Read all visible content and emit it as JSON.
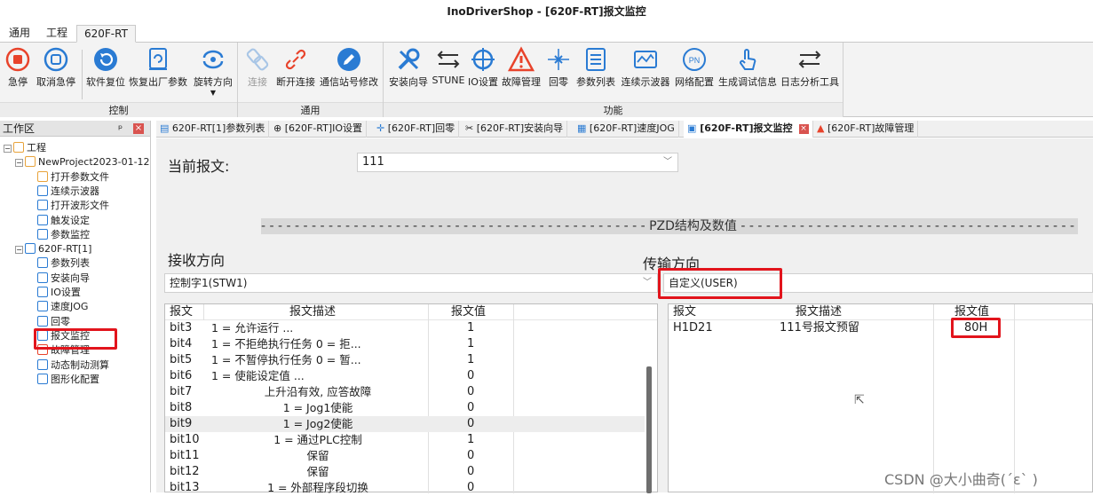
{
  "window": {
    "title": "InoDriverShop - [620F-RT]报文监控"
  },
  "menu_tabs": [
    "通用",
    "工程",
    "620F-RT"
  ],
  "ribbon": {
    "groups": [
      {
        "label": "控制",
        "buttons": [
          {
            "label": "急停",
            "icon": "stop-icon"
          },
          {
            "label": "取消急停",
            "icon": "cancel-stop-icon"
          },
          {
            "label": "软件复位",
            "icon": "reset-icon"
          },
          {
            "label": "恢复出厂参数",
            "icon": "factory-reset-icon"
          },
          {
            "label": "旋转方向",
            "icon": "rotate-direction-icon"
          }
        ]
      },
      {
        "label": "通用",
        "buttons": [
          {
            "label": "连接",
            "icon": "connect-icon"
          },
          {
            "label": "断开连接",
            "icon": "disconnect-icon"
          },
          {
            "label": "通信站号修改",
            "icon": "edit-station-icon"
          }
        ]
      },
      {
        "label": "功能",
        "buttons": [
          {
            "label": "安装向导",
            "icon": "wrench-icon"
          },
          {
            "label": "STUNE",
            "icon": "stune-icon"
          },
          {
            "label": "IO设置",
            "icon": "crosshair-icon"
          },
          {
            "label": "故障管理",
            "icon": "warning-icon"
          },
          {
            "label": "回零",
            "icon": "home-icon"
          },
          {
            "label": "参数列表",
            "icon": "list-icon"
          },
          {
            "label": "连续示波器",
            "icon": "oscilloscope-icon"
          },
          {
            "label": "网络配置",
            "icon": "network-icon"
          },
          {
            "label": "生成调试信息",
            "icon": "hand-icon"
          },
          {
            "label": "日志分析工具",
            "icon": "log-icon"
          }
        ]
      }
    ]
  },
  "workpane": {
    "title": "工作区",
    "pin": "ᵖ",
    "tree": [
      {
        "label": "工程",
        "level": 0,
        "icon": "folder-icon"
      },
      {
        "label": "NewProject2023-01-12",
        "level": 1,
        "icon": "folder-open-icon"
      },
      {
        "label": "打开参数文件",
        "level": 2,
        "icon": "folder-open-icon"
      },
      {
        "label": "连续示波器",
        "level": 2,
        "icon": "oscilloscope-icon"
      },
      {
        "label": "打开波形文件",
        "level": 2,
        "icon": "wave-file-icon"
      },
      {
        "label": "触发设定",
        "level": 2,
        "icon": "trigger-icon"
      },
      {
        "label": "参数监控",
        "level": 2,
        "icon": "monitor-icon"
      },
      {
        "label": "620F-RT[1]",
        "level": 1,
        "icon": "device-icon"
      },
      {
        "label": "参数列表",
        "level": 2,
        "icon": "list-icon"
      },
      {
        "label": "安装向导",
        "level": 2,
        "icon": "wrench-icon"
      },
      {
        "label": "IO设置",
        "level": 2,
        "icon": "crosshair-icon"
      },
      {
        "label": "速度JOG",
        "level": 2,
        "icon": "jog-icon"
      },
      {
        "label": "回零",
        "level": 2,
        "icon": "home-icon"
      },
      {
        "label": "报文监控",
        "level": 2,
        "icon": "telegram-icon"
      },
      {
        "label": "故障管理",
        "level": 2,
        "icon": "warning-icon"
      },
      {
        "label": "动态制动测算",
        "level": 2,
        "icon": "brake-icon"
      },
      {
        "label": "图形化配置",
        "level": 2,
        "icon": "graph-config-icon"
      }
    ]
  },
  "doc_tabs": [
    {
      "label": "620F-RT[1]参数列表",
      "icon": "list-icon"
    },
    {
      "label": "[620F-RT]IO设置",
      "icon": "crosshair-icon"
    },
    {
      "label": "[620F-RT]回零",
      "icon": "home-icon"
    },
    {
      "label": "[620F-RT]安装向导",
      "icon": "wrench-icon"
    },
    {
      "label": "[620F-RT]速度JOG",
      "icon": "jog-icon"
    },
    {
      "label": "[620F-RT]报文监控",
      "icon": "telegram-icon"
    },
    {
      "label": "[620F-RT]故障管理",
      "icon": "warning-icon"
    }
  ],
  "telegram": {
    "label": "当前报文:",
    "value": "111",
    "section_title": "PZD结构及数值"
  },
  "receive": {
    "title": "接收方向",
    "selected": "控制字1(STW1)",
    "headers": [
      "报文",
      "报文描述",
      "报文值"
    ],
    "rows": [
      {
        "bit": "bit3",
        "desc": "1 = 允许运行                       ...",
        "value": "1"
      },
      {
        "bit": "bit4",
        "desc": "1 = 不拒绝执行任务     0 = 拒...",
        "value": "1"
      },
      {
        "bit": "bit5",
        "desc": "1 = 不暂停执行任务     0 = 暂...",
        "value": "1"
      },
      {
        "bit": "bit6",
        "desc": "1 = 使能设定值                   ...",
        "value": "0"
      },
      {
        "bit": "bit7",
        "desc": "上升沿有效, 应答故障",
        "value": "0"
      },
      {
        "bit": "bit8",
        "desc": "1 = Jog1使能",
        "value": "0"
      },
      {
        "bit": "bit9",
        "desc": "1 = Jog2使能",
        "value": "0"
      },
      {
        "bit": "bit10",
        "desc": "1 = 通过PLC控制",
        "value": "1"
      },
      {
        "bit": "bit11",
        "desc": "保留",
        "value": "0"
      },
      {
        "bit": "bit12",
        "desc": "保留",
        "value": "0"
      },
      {
        "bit": "bit13",
        "desc": "1 = 外部程序段切换",
        "value": "0"
      }
    ]
  },
  "transmit": {
    "title": "传输方向",
    "selected": "自定义(USER)",
    "headers": [
      "报文",
      "报文描述",
      "报文值"
    ],
    "rows": [
      {
        "bit": "H1D21",
        "desc": "111号报文预留",
        "value": "80H"
      }
    ]
  },
  "watermark": "CSDN @大小曲奇(ˊɛˋ   )"
}
